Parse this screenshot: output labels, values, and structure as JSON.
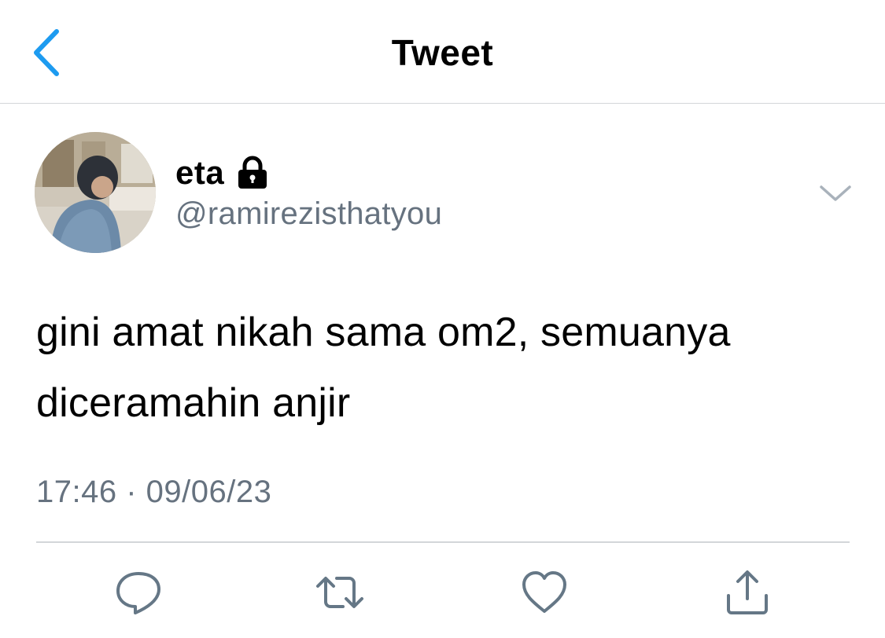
{
  "header": {
    "title": "Tweet",
    "back_icon": "chevron-left-icon"
  },
  "tweet": {
    "author": {
      "display_name": "eta",
      "handle": "@ramirezisthatyou",
      "protected_icon": "lock-icon"
    },
    "text_lines": [
      "gini amat nikah sama om2, semuanya",
      "diceramahin anjir"
    ],
    "timestamp": "17:46 · 09/06/23"
  },
  "actions": [
    {
      "name": "reply",
      "icon": "comment-icon"
    },
    {
      "name": "retweet",
      "icon": "retweet-icon"
    },
    {
      "name": "like",
      "icon": "heart-icon"
    },
    {
      "name": "share",
      "icon": "share-icon"
    }
  ],
  "colors": {
    "accent": "#1d9bf0",
    "secondary_text": "#66727f",
    "icon_gray": "#657786",
    "divider": "#d3d6d9"
  }
}
